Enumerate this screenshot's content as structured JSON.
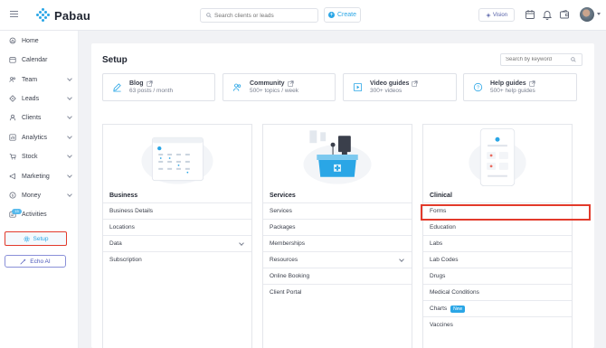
{
  "app": {
    "name": "Pabau"
  },
  "topbar": {
    "search_placeholder": "Search clients or leads",
    "create_label": "Create",
    "vision_label": "Vision",
    "icons": [
      "menu-icon",
      "calendar-icon",
      "bell-icon",
      "wallet-icon",
      "avatar"
    ]
  },
  "sidebar": {
    "items": [
      {
        "label": "Home",
        "icon": "home-icon",
        "expandable": false
      },
      {
        "label": "Calendar",
        "icon": "calendar-icon",
        "expandable": false
      },
      {
        "label": "Team",
        "icon": "team-icon",
        "expandable": true
      },
      {
        "label": "Leads",
        "icon": "leads-icon",
        "expandable": true
      },
      {
        "label": "Clients",
        "icon": "clients-icon",
        "expandable": true
      },
      {
        "label": "Analytics",
        "icon": "analytics-icon",
        "expandable": true
      },
      {
        "label": "Stock",
        "icon": "stock-icon",
        "expandable": true
      },
      {
        "label": "Marketing",
        "icon": "marketing-icon",
        "expandable": true
      },
      {
        "label": "Money",
        "icon": "money-icon",
        "expandable": true
      },
      {
        "label": "Activities",
        "icon": "activities-icon",
        "expandable": false
      }
    ],
    "activities_badge": "15",
    "setup_label": "Setup",
    "echo_label": "Echo AI"
  },
  "main": {
    "title": "Setup",
    "search_placeholder": "Search by keyword",
    "resources": [
      {
        "title": "Blog",
        "subtitle": "63 posts / month"
      },
      {
        "title": "Community",
        "subtitle": "500+ topics / week"
      },
      {
        "title": "Video guides",
        "subtitle": "300+ videos"
      },
      {
        "title": "Help guides",
        "subtitle": "500+ help guides"
      }
    ],
    "columns": [
      {
        "title": "Business",
        "rows": [
          "Business Details",
          "Locations",
          "Data",
          "Subscription"
        ],
        "dropdown_rows": [
          "Data"
        ]
      },
      {
        "title": "Services",
        "rows": [
          "Services",
          "Packages",
          "Memberships",
          "Resources",
          "Online Booking",
          "Client Portal"
        ],
        "dropdown_rows": [
          "Resources"
        ]
      },
      {
        "title": "Clinical",
        "rows": [
          "Forms",
          "Education",
          "Labs",
          "Lab Codes",
          "Drugs",
          "Medical Conditions",
          "Charts",
          "Vaccines"
        ],
        "new_badge_row": "Charts",
        "new_badge_label": "New"
      }
    ]
  },
  "colors": {
    "accent": "#2aa6e6",
    "highlight": "#e23a2b",
    "echo": "#4a55b8"
  }
}
